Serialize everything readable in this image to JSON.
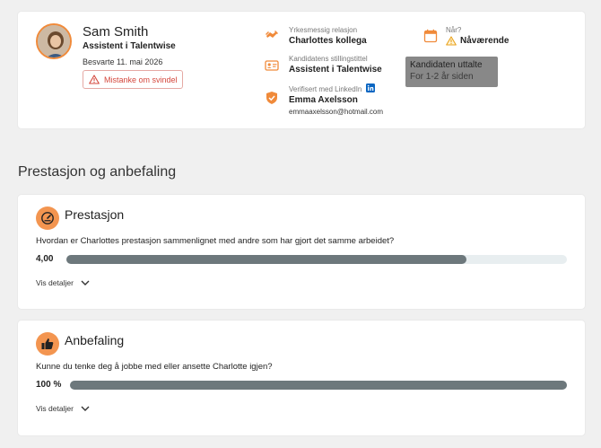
{
  "candidate": {
    "name": "Sam Smith",
    "role": "Assistent i Talentwise",
    "answered": "Besvarte 11. mai 2026",
    "fraud_label": "Mistanke om svindel"
  },
  "relation": {
    "label": "Yrkesmessig relasjon",
    "value": "Charlottes kollega"
  },
  "job_title": {
    "label": "Kandidatens stillingstittel",
    "value": "Assistent i Talentwise"
  },
  "verified": {
    "label": "Verifisert med LinkedIn",
    "name": "Emma Axelsson",
    "email": "emmaaxelsson@hotmail.com"
  },
  "when": {
    "label": "Når?",
    "value": "Nåværende"
  },
  "tooltip": {
    "line1": "Kandidaten uttalte",
    "line2": "For 1-2 år siden"
  },
  "section_title": "Prestasjon og anbefaling",
  "questions": [
    {
      "title": "Prestasjon",
      "question": "Hvordan er Charlottes prestasjon sammenlignet med andre som har gjort det samme arbeidet?",
      "score": "4,00",
      "fill_fraction": 0.8,
      "details_label": "Vis detaljer"
    },
    {
      "title": "Anbefaling",
      "question": "Kunne du tenke deg å jobbe med eller ansette Charlotte igjen?",
      "score": "100 %",
      "fill_fraction": 1.0,
      "details_label": "Vis detaljer"
    }
  ],
  "colors": {
    "accent": "#f08a3a",
    "bar_fill": "#6d787c",
    "bar_track": "#e8eef0",
    "danger": "#d4473c",
    "linkedin": "#0a66c2"
  }
}
